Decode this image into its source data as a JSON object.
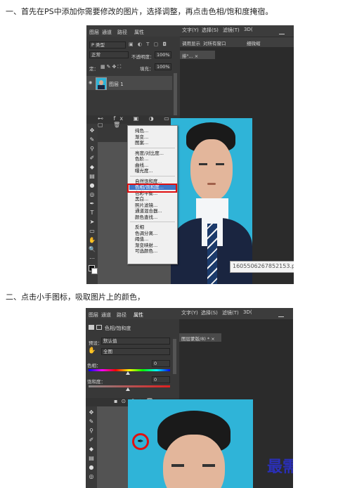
{
  "step1": {
    "text": "一、首先在PS中添加你需要修改的图片，选择调整，再点击色相/饱和度掩宿。"
  },
  "step2": {
    "text": "二、点击小手图标，吸取图片上的颜色，"
  },
  "shot1": {
    "panel_tabs": [
      "图层",
      "通道",
      "路径",
      "属性"
    ],
    "top_tabs": [
      "文字(Y)",
      "选择(S)",
      "滤镜(T)",
      "3D("
    ],
    "kind_filter": "P 类型",
    "blend_mode": "正常",
    "opacity_label": "不透明度：",
    "opacity_value": "100%",
    "lock_label": "定：",
    "fill_label": "填充：",
    "fill_value": "100%",
    "layer_name": "图层 1",
    "options_labels": [
      "调用显示",
      "对所有窗口",
      "细微缩"
    ],
    "doc_tab": "排\"... ×",
    "filename_tooltip": "1605506267852153.png",
    "adjust_menu": {
      "groups": [
        [
          "纯色...",
          "渐变...",
          "图案..."
        ],
        [
          "亮度/对比度...",
          "色阶...",
          "曲线...",
          "曝光度..."
        ],
        [
          "自然饱和度...",
          "色相/饱和度...",
          "色彩平衡...",
          "黑白...",
          "照片滤镜...",
          "通道混合器...",
          "颜色查找..."
        ],
        [
          "反相",
          "色调分离...",
          "阈值...",
          "渐变映射...",
          "可选颜色..."
        ]
      ],
      "selected": "色相/饱和度..."
    }
  },
  "shot2": {
    "panel_tabs": [
      "图层",
      "通道",
      "路径",
      "属性"
    ],
    "top_tabs": [
      "文字(Y)",
      "选择(S)",
      "滤镜(T)",
      "3D("
    ],
    "props_title": "色相/饱和度",
    "preset_label": "预设：",
    "preset_value": "默认值",
    "channel_value": "全图",
    "hue_label": "色相：",
    "hue_value": "0",
    "sat_label": "饱和度：",
    "sat_value": "0",
    "doc_tab": "图层蒙版/8) * ×"
  },
  "watermark": "最需教育",
  "colors": {
    "ps_dark": "#535353",
    "ps_panel": "#383838",
    "menu_highlight": "#3f76c7",
    "red": "#e01010",
    "photo_bg": "#2fb4d8"
  }
}
